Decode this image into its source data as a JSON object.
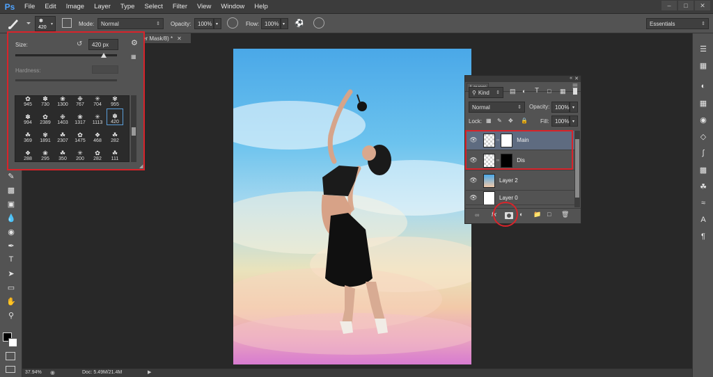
{
  "menubar": {
    "logo": "Ps",
    "items": [
      "File",
      "Edit",
      "Image",
      "Layer",
      "Type",
      "Select",
      "Filter",
      "View",
      "Window",
      "Help"
    ]
  },
  "options": {
    "brush_size_preview": "420",
    "mode_label": "Mode:",
    "mode_value": "Normal",
    "opacity_label": "Opacity:",
    "opacity_value": "100%",
    "flow_label": "Flow:",
    "flow_value": "100%",
    "workspace": "Essentials"
  },
  "brush_popup": {
    "size_label": "Size:",
    "size_value": "420 px",
    "hardness_label": "Hardness:",
    "brushes": [
      [
        "945",
        "730",
        "1300",
        "767",
        "704",
        "955"
      ],
      [
        "994",
        "2389",
        "1403",
        "1317",
        "1113",
        "420"
      ],
      [
        "369",
        "1891",
        "2307",
        "1475",
        "468",
        "282"
      ],
      [
        "288",
        "295",
        "350",
        "200",
        "282",
        "111"
      ]
    ],
    "selected_brush": "420"
  },
  "document": {
    "tab_title": "er Mask/8) *",
    "zoom": "37.94%",
    "doc_info": "Doc: 5.49M/21.4M"
  },
  "layers_panel": {
    "title": "Layers",
    "filter_kind": "Kind",
    "blend_mode": "Normal",
    "opacity_label": "Opacity:",
    "opacity_value": "100%",
    "lock_label": "Lock:",
    "fill_label": "Fill:",
    "fill_value": "100%",
    "layers": [
      {
        "name": "Main",
        "selected": true
      },
      {
        "name": "Dis",
        "selected": false
      },
      {
        "name": "Layer 2",
        "selected": false
      },
      {
        "name": "Layer 0",
        "selected": false
      }
    ]
  },
  "colors": {
    "highlight": "#d9232a",
    "selected_layer": "#5e6b80",
    "panel_bg": "#535353"
  }
}
